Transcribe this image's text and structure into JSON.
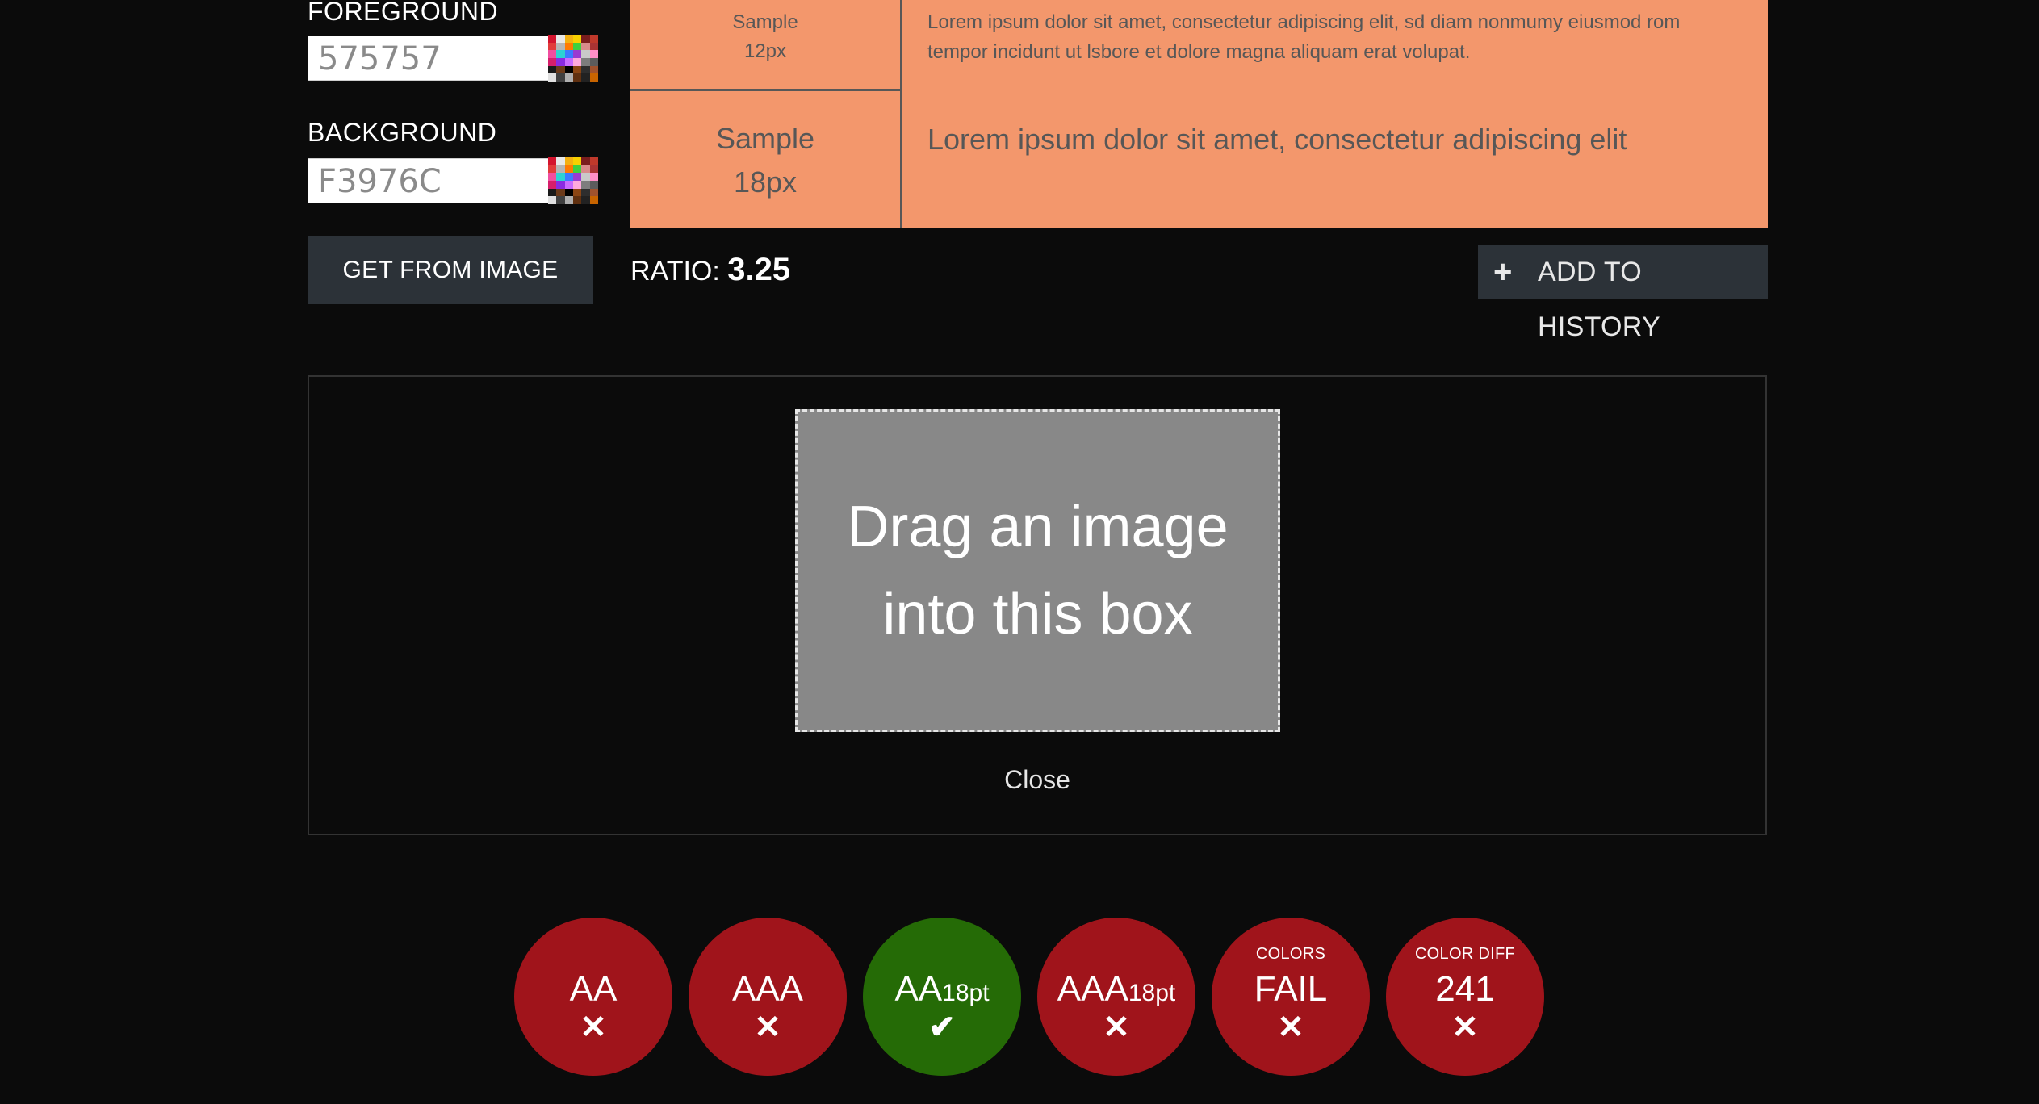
{
  "colors": {
    "page_bg": "#0b0b0b",
    "foreground": "#575757",
    "background": "#F3976C",
    "button_bg": "#2c3238",
    "fail": "#a0141b",
    "pass": "#256b06"
  },
  "foreground": {
    "label": "FOREGROUND",
    "value": "575757",
    "picker_icon": "palette-icon"
  },
  "background": {
    "label": "BACKGROUND",
    "value": "F3976C",
    "picker_icon": "palette-icon"
  },
  "get_from_image": "GET FROM IMAGE",
  "preview": {
    "rows": [
      {
        "sample": "Sample",
        "size": "12px",
        "text": "Lorem ipsum dolor sit amet, consectetur adipiscing elit, sd diam nonmumy eiusmod rom tempor incidunt ut lsbore et dolore magna aliquam erat volupat."
      },
      {
        "sample": "Sample",
        "size": "18px",
        "text": "Lorem ipsum dolor sit amet, consectetur adipiscing elit"
      }
    ]
  },
  "ratio": {
    "label": "RATIO:",
    "value": "3.25"
  },
  "add_history": {
    "icon": "plus-icon",
    "label": "ADD TO HISTORY"
  },
  "dropzone": {
    "line1": "Drag an image",
    "line2": "into this box",
    "close": "Close"
  },
  "results": [
    {
      "title": "AA",
      "suffix": "",
      "caption": "",
      "status": "fail",
      "icon": "x-icon"
    },
    {
      "title": "AAA",
      "suffix": "",
      "caption": "",
      "status": "fail",
      "icon": "x-icon"
    },
    {
      "title": "AA",
      "suffix": "18pt",
      "caption": "",
      "status": "pass",
      "icon": "check-icon"
    },
    {
      "title": "AAA",
      "suffix": "18pt",
      "caption": "",
      "status": "fail",
      "icon": "x-icon"
    },
    {
      "title": "FAIL",
      "suffix": "",
      "caption": "COLORS",
      "status": "fail",
      "icon": "x-icon"
    },
    {
      "title": "241",
      "suffix": "",
      "caption": "COLOR DIFF",
      "status": "fail",
      "icon": "x-icon"
    }
  ],
  "swatch_colors": [
    "#d4142e",
    "#e8e8e8",
    "#f3b012",
    "#f7d000",
    "#7a1d1d",
    "#c0392b",
    "#e23b3b",
    "#b5b5b5",
    "#ff7a00",
    "#3fcf3f",
    "#d98a8a",
    "#a33",
    "#f04ea0",
    "#2bd3d3",
    "#3b7bff",
    "#9a3bd1",
    "#c9c9c9",
    "#ff8fc7",
    "#d61f6b",
    "#8a2be2",
    "#c96bff",
    "#ffaadd",
    "#7d7d7d",
    "#5c5c5c",
    "#1a1a1a",
    "#6b3a1a",
    "#000000",
    "#8b4513",
    "#2e2e2e",
    "#a0522d",
    "#e0e0e0",
    "#404040",
    "#b0b0b0",
    "#603010",
    "#222222",
    "#c86400"
  ]
}
